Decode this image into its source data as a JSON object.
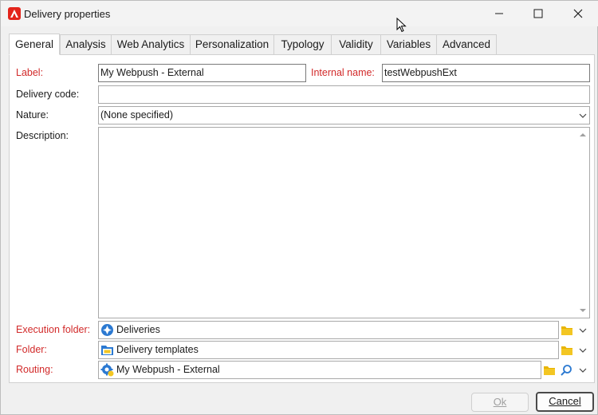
{
  "window": {
    "title": "Delivery properties",
    "minimize_icon": "minimize-icon",
    "maximize_icon": "maximize-icon",
    "close_icon": "close-icon"
  },
  "tabs": [
    {
      "label": "General",
      "active": true
    },
    {
      "label": "Analysis"
    },
    {
      "label": "Web Analytics"
    },
    {
      "label": "Personalization"
    },
    {
      "label": "Typology"
    },
    {
      "label": "Validity"
    },
    {
      "label": "Variables"
    },
    {
      "label": "Advanced"
    }
  ],
  "form": {
    "label": {
      "label": "Label:",
      "value": "My Webpush - External"
    },
    "internal_name": {
      "label": "Internal name:",
      "value": "testWebpushExt"
    },
    "delivery_code": {
      "label": "Delivery code:",
      "value": ""
    },
    "nature": {
      "label": "Nature:",
      "value": "(None specified)"
    },
    "description": {
      "label": "Description:",
      "value": ""
    },
    "execution_folder": {
      "label": "Execution folder:",
      "value": "Deliveries"
    },
    "folder": {
      "label": "Folder:",
      "value": "Delivery templates"
    },
    "routing": {
      "label": "Routing:",
      "value": "My Webpush - External"
    }
  },
  "buttons": {
    "ok": "Ok",
    "cancel": "Cancel"
  },
  "colors": {
    "required_label": "#d22a2a",
    "folder_icon": "#e8b400",
    "accent_blue": "#2b79d1",
    "app_icon": "#e3241b"
  }
}
